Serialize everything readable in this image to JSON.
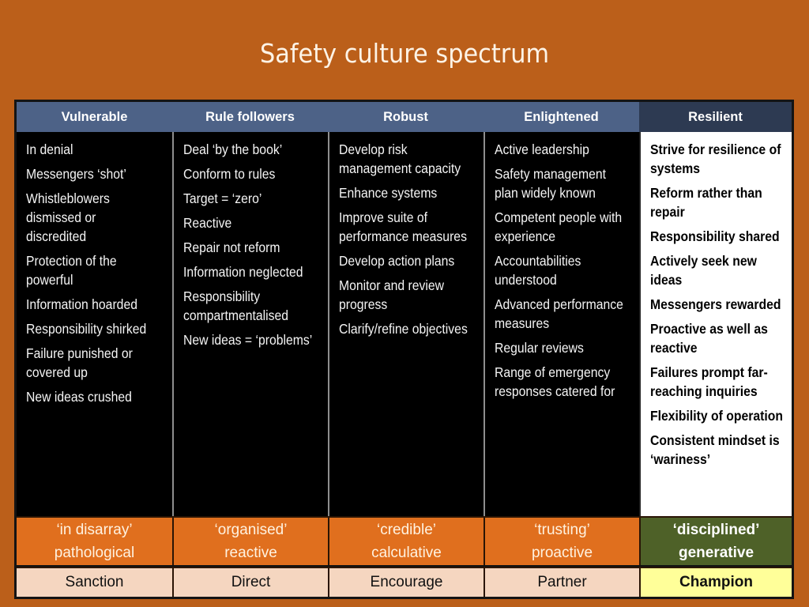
{
  "title": "Safety culture spectrum",
  "colors": {
    "background": "#bb5f1a",
    "header_blue": "#4d6287",
    "header_dark": "#2d3a52",
    "band_orange": "#e06f1e",
    "band_green": "#4e6128",
    "action_peach": "#f5d6c0",
    "action_yellow": "#ffff99"
  },
  "columns": [
    {
      "header": "Vulnerable",
      "items": [
        [
          "In denial"
        ],
        [
          "Messengers ‘shot’"
        ],
        [
          "Whistleblowers",
          "dismissed or",
          "discredited"
        ],
        [
          "Protection of the",
          "powerful"
        ],
        [
          "Information hoarded"
        ],
        [
          "Responsibility shirked"
        ],
        [
          "Failure punished or",
          "covered up"
        ],
        [
          "New ideas crushed"
        ]
      ],
      "band": [
        "‘in disarray’",
        "pathological"
      ],
      "action": "Sanction"
    },
    {
      "header": "Rule followers",
      "items": [
        [
          "Deal ‘by the book’"
        ],
        [
          "Conform to rules"
        ],
        [
          "Target = ‘zero’"
        ],
        [
          "Reactive"
        ],
        [
          "Repair not reform"
        ],
        [
          "Information neglected"
        ],
        [
          "Responsibility",
          "compartmentalised"
        ],
        [
          "New ideas = ‘problems’"
        ]
      ],
      "band": [
        "‘organised’",
        "reactive"
      ],
      "action": "Direct"
    },
    {
      "header": "Robust",
      "items": [
        [
          "Develop risk",
          "management capacity"
        ],
        [
          "Enhance systems"
        ],
        [
          "Improve suite of",
          "performance measures"
        ],
        [
          "Develop action plans"
        ],
        [
          "Monitor and review",
          "progress"
        ],
        [
          "Clarify/refine objectives"
        ]
      ],
      "band": [
        "‘credible’",
        "calculative"
      ],
      "action": "Encourage"
    },
    {
      "header": "Enlightened",
      "items": [
        [
          "Active leadership"
        ],
        [
          "Safety management",
          "plan widely known"
        ],
        [
          "Competent people with",
          "experience"
        ],
        [
          "Accountabilities",
          "understood"
        ],
        [
          "Advanced performance",
          "measures"
        ],
        [
          "Regular reviews"
        ],
        [
          "Range of emergency",
          "responses catered for"
        ]
      ],
      "band": [
        "‘trusting’",
        "proactive"
      ],
      "action": "Partner"
    },
    {
      "header": "Resilient",
      "items": [
        [
          "Strive for resilience of",
          "systems"
        ],
        [
          "Reform rather than",
          "repair"
        ],
        [
          "Responsibility shared"
        ],
        [
          "Actively seek new",
          "ideas"
        ],
        [
          "Messengers rewarded"
        ],
        [
          "Proactive as well as",
          "reactive"
        ],
        [
          "Failures prompt far-",
          "reaching inquiries"
        ],
        [
          "Flexibility of operation"
        ],
        [
          "Consistent mindset is",
          "‘wariness’"
        ]
      ],
      "band": [
        "‘disciplined’",
        "generative"
      ],
      "action": "Champion"
    }
  ]
}
